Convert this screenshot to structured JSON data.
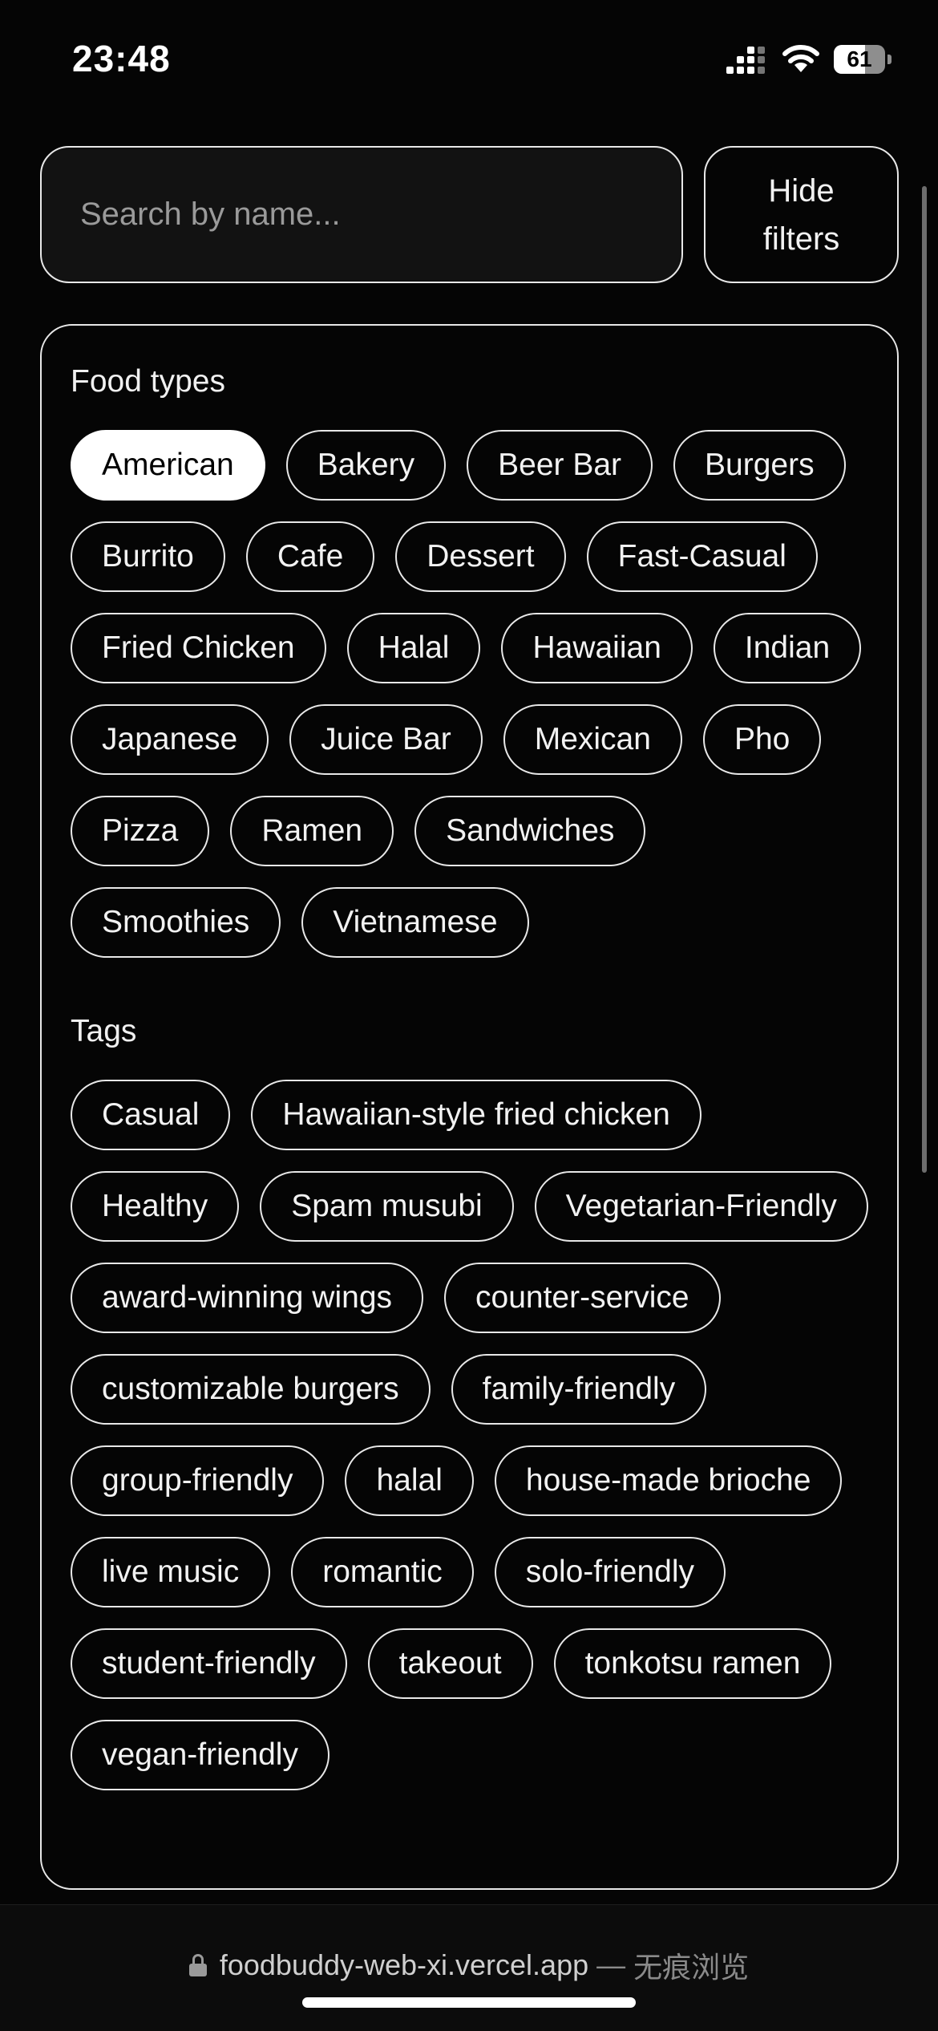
{
  "status_bar": {
    "time": "23:48",
    "battery": "61",
    "battery_level": 0.61,
    "icons": [
      "signal-icon",
      "wifi-icon",
      "battery-icon"
    ]
  },
  "search": {
    "placeholder": "Search by name...",
    "value": ""
  },
  "hide_filters_label": "Hide filters",
  "filters": {
    "food_types": {
      "title": "Food types",
      "items": [
        {
          "label": "American",
          "selected": true
        },
        {
          "label": "Bakery",
          "selected": false
        },
        {
          "label": "Beer Bar",
          "selected": false
        },
        {
          "label": "Burgers",
          "selected": false
        },
        {
          "label": "Burrito",
          "selected": false
        },
        {
          "label": "Cafe",
          "selected": false
        },
        {
          "label": "Dessert",
          "selected": false
        },
        {
          "label": "Fast-Casual",
          "selected": false
        },
        {
          "label": "Fried Chicken",
          "selected": false
        },
        {
          "label": "Halal",
          "selected": false
        },
        {
          "label": "Hawaiian",
          "selected": false
        },
        {
          "label": "Indian",
          "selected": false
        },
        {
          "label": "Japanese",
          "selected": false
        },
        {
          "label": "Juice Bar",
          "selected": false
        },
        {
          "label": "Mexican",
          "selected": false
        },
        {
          "label": "Pho",
          "selected": false
        },
        {
          "label": "Pizza",
          "selected": false
        },
        {
          "label": "Ramen",
          "selected": false
        },
        {
          "label": "Sandwiches",
          "selected": false
        },
        {
          "label": "Smoothies",
          "selected": false
        },
        {
          "label": "Vietnamese",
          "selected": false
        }
      ]
    },
    "tags": {
      "title": "Tags",
      "items": [
        {
          "label": "Casual",
          "selected": false
        },
        {
          "label": "Hawaiian-style fried chicken",
          "selected": false
        },
        {
          "label": "Healthy",
          "selected": false
        },
        {
          "label": "Spam musubi",
          "selected": false
        },
        {
          "label": "Vegetarian-Friendly",
          "selected": false
        },
        {
          "label": "award-winning wings",
          "selected": false
        },
        {
          "label": "counter-service",
          "selected": false
        },
        {
          "label": "customizable burgers",
          "selected": false
        },
        {
          "label": "family-friendly",
          "selected": false
        },
        {
          "label": "group-friendly",
          "selected": false
        },
        {
          "label": "halal",
          "selected": false
        },
        {
          "label": "house-made brioche",
          "selected": false
        },
        {
          "label": "live music",
          "selected": false
        },
        {
          "label": "romantic",
          "selected": false
        },
        {
          "label": "solo-friendly",
          "selected": false
        },
        {
          "label": "student-friendly",
          "selected": false
        },
        {
          "label": "takeout",
          "selected": false
        },
        {
          "label": "tonkotsu ramen",
          "selected": false
        },
        {
          "label": "vegan-friendly",
          "selected": false
        }
      ]
    }
  },
  "browser": {
    "url": "foodbuddy-web-xi.vercel.app",
    "separator": "—",
    "mode_label": "无痕浏览",
    "icons": [
      "lock-icon"
    ]
  },
  "colors": {
    "background": "#050505",
    "border": "#e8e8e8",
    "selected_chip_bg": "#ffffff",
    "selected_chip_text": "#000000",
    "text": "#f2f2f2"
  }
}
